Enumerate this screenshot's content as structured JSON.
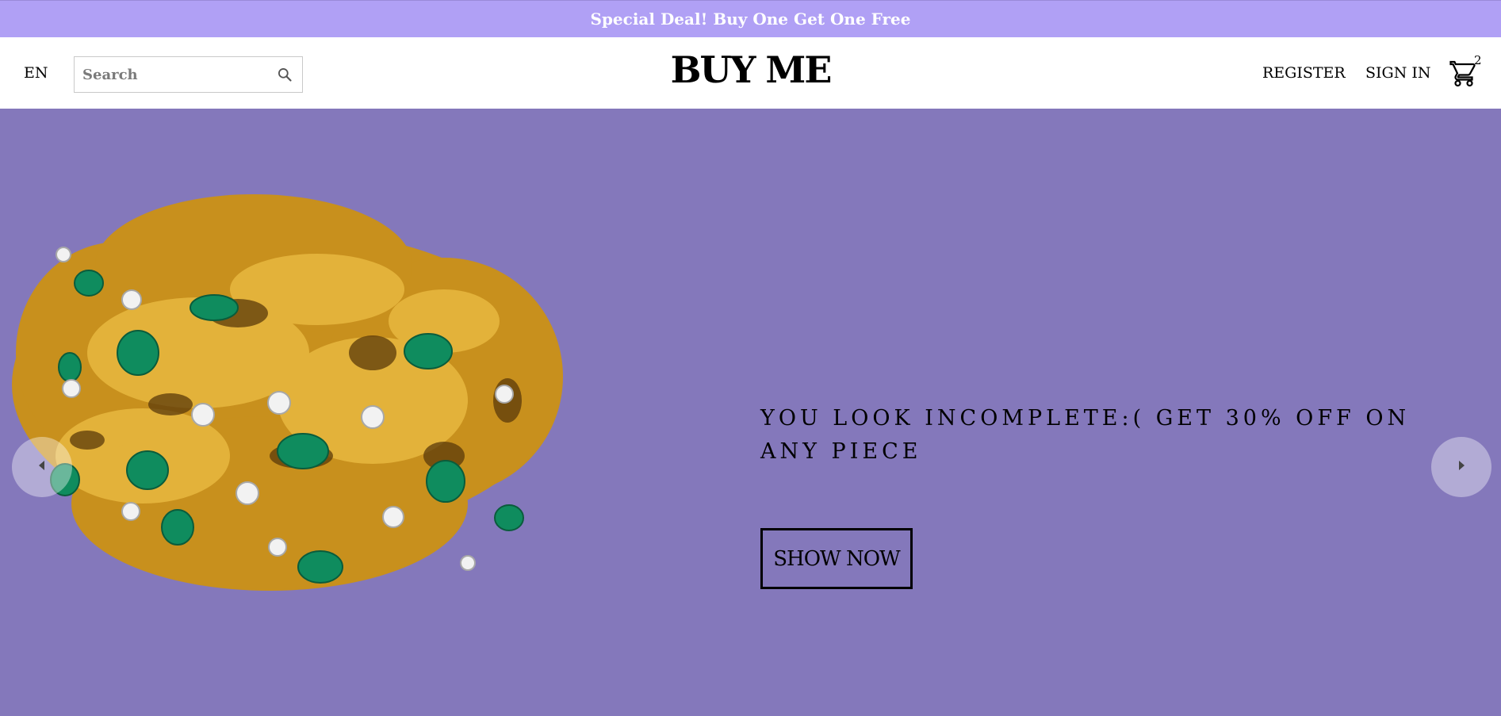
{
  "announcement": {
    "text": "Special Deal! Buy One Get One Free"
  },
  "header": {
    "language": "EN",
    "search": {
      "placeholder": "Search",
      "value": ""
    },
    "logo": "BUY ME",
    "register_label": "REGISTER",
    "signin_label": "SIGN IN",
    "cart_count": "2"
  },
  "hero": {
    "headline": "YOU LOOK INCOMPLETE:( GET 30% OFF ON ANY PIECE",
    "button_label": "SHOW NOW",
    "product_image": "gold-emerald-diamond-bracelet"
  },
  "colors": {
    "announcement_bg": "#b0a0f5",
    "hero_bg": "#8478bb",
    "gold": "#d4a12a",
    "emerald": "#0f8c5e"
  },
  "icons": {
    "search": "search-icon",
    "cart": "shopping-cart-icon",
    "prev": "chevron-left-icon",
    "next": "chevron-right-icon"
  }
}
